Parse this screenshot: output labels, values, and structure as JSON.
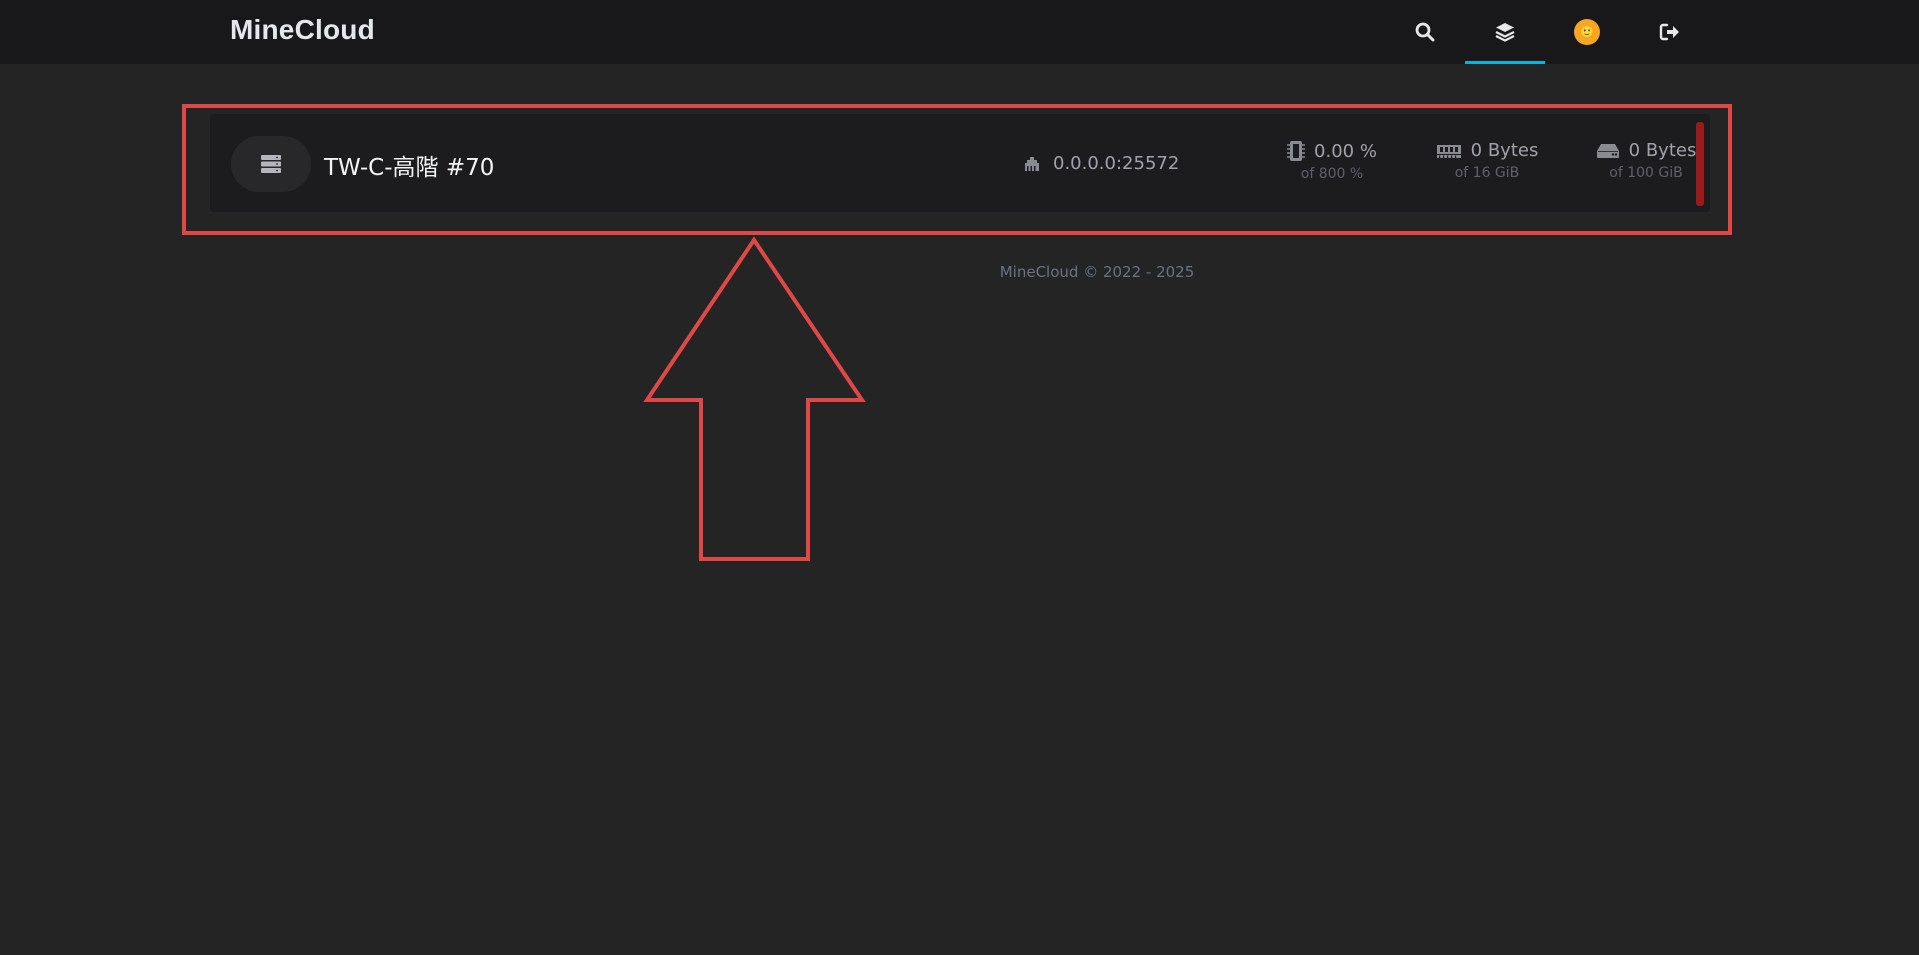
{
  "header": {
    "brand": "MineCloud",
    "nav": [
      {
        "name": "search",
        "icon": "search-icon"
      },
      {
        "name": "servers",
        "icon": "layers-icon",
        "active": true
      },
      {
        "name": "account",
        "icon": "avatar-icon"
      },
      {
        "name": "logout",
        "icon": "sign-out-icon"
      }
    ],
    "avatar_glyph": "🙂"
  },
  "server": {
    "name": "TW-C-高階 #70",
    "address": "0.0.0.0:25572",
    "cpu": {
      "value": "0.00 %",
      "limit": "of 800 %"
    },
    "memory": {
      "value": "0 Bytes",
      "limit": "of 16 GiB"
    },
    "disk": {
      "value": "0 Bytes",
      "limit": "of 100 GiB"
    },
    "status_color": "#991b1b"
  },
  "footer": {
    "text": "MineCloud © 2022 - 2025"
  },
  "colors": {
    "background": "#242424",
    "navbar": "#18181b",
    "accent": "#06b6d4",
    "annotation": "#e04848"
  }
}
